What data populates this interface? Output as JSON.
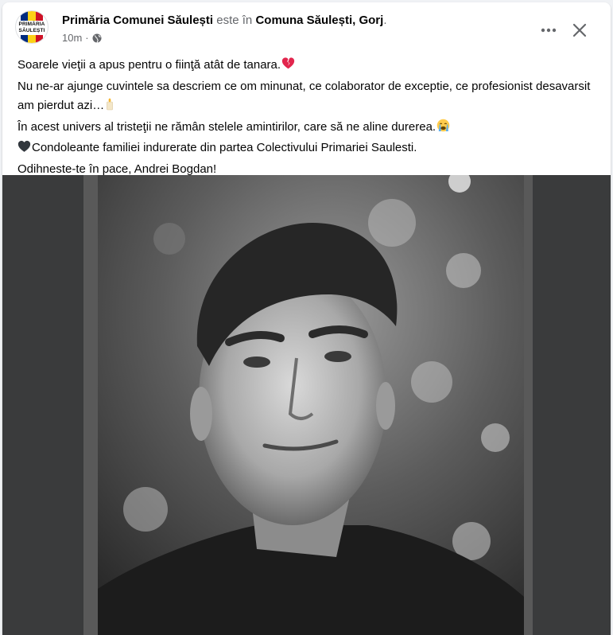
{
  "post": {
    "page_name": "Primăria Comunei Săulești",
    "connector": "este în",
    "location": "Comuna Săulești, Gorj",
    "location_suffix": ".",
    "time": "10m",
    "dot": "·",
    "avatar": {
      "line1": "PRIMĂRIA",
      "line2": "SĂULEȘTI",
      "flag_colors": [
        "#002b7f",
        "#fcd116",
        "#ce1126"
      ]
    },
    "more_icon": "more-horizontal-icon",
    "close_icon": "close-icon",
    "privacy_icon": "globe-icon",
    "text_lines": [
      {
        "text": "Soarele vieţii a apus pentru o fiinţă atât de tanara.",
        "emoji": "broken-heart-icon"
      },
      {
        "text": "Nu ne-ar ajunge cuvintele sa descriem ce om minunat, ce colaborator de exceptie, ce profesionist desavarsit am pierdut azi…",
        "emoji": "candle-icon"
      },
      {
        "text": "În acest univers al tristeţii ne rămân stelele amintirilor, care să ne aline durerea.",
        "emoji": "crying-face-icon"
      },
      {
        "text": "Condoleante familiei indurerate din partea Colectivului Primariei Saulesti.",
        "emoji_before": "black-heart-icon"
      },
      {
        "text": "Odihneste-te în pace, Andrei Bogdan!"
      }
    ],
    "photo_description_icon": "memorial-photo"
  },
  "colors": {
    "primary_text": "#050505",
    "secondary_text": "#65676b",
    "media_background": "#3a3b3c",
    "card_background": "#ffffff"
  }
}
